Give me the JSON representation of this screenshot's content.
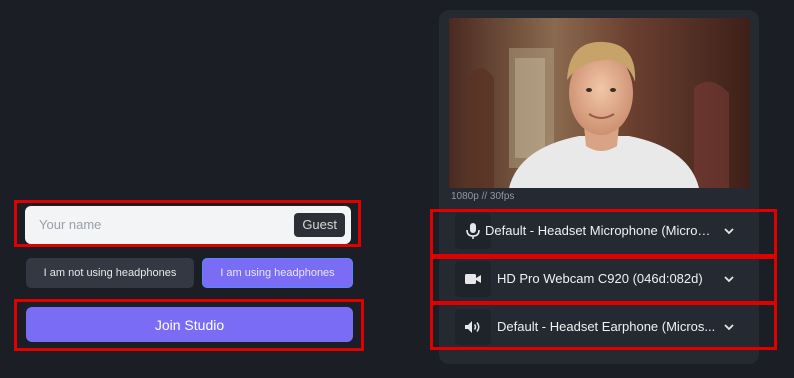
{
  "join_form": {
    "name_placeholder": "Your name",
    "guest_label": "Guest",
    "headphones_off_label": "I am not using headphones",
    "headphones_on_label": "I am using headphones",
    "join_label": "Join Studio"
  },
  "preview": {
    "resolution_label": "1080p // 30fps"
  },
  "devices": {
    "microphone": {
      "label": "Default - Headset Microphone (Micros...",
      "icon": "microphone-icon"
    },
    "camera": {
      "label": "HD Pro Webcam C920 (046d:082d)",
      "icon": "camera-icon"
    },
    "speaker": {
      "label": "Default - Headset Earphone (Micros...",
      "icon": "speaker-icon"
    }
  },
  "colors": {
    "accent": "#7b6cf6",
    "background": "#1b1e24",
    "panel": "#252932",
    "highlight": "#e00000"
  }
}
